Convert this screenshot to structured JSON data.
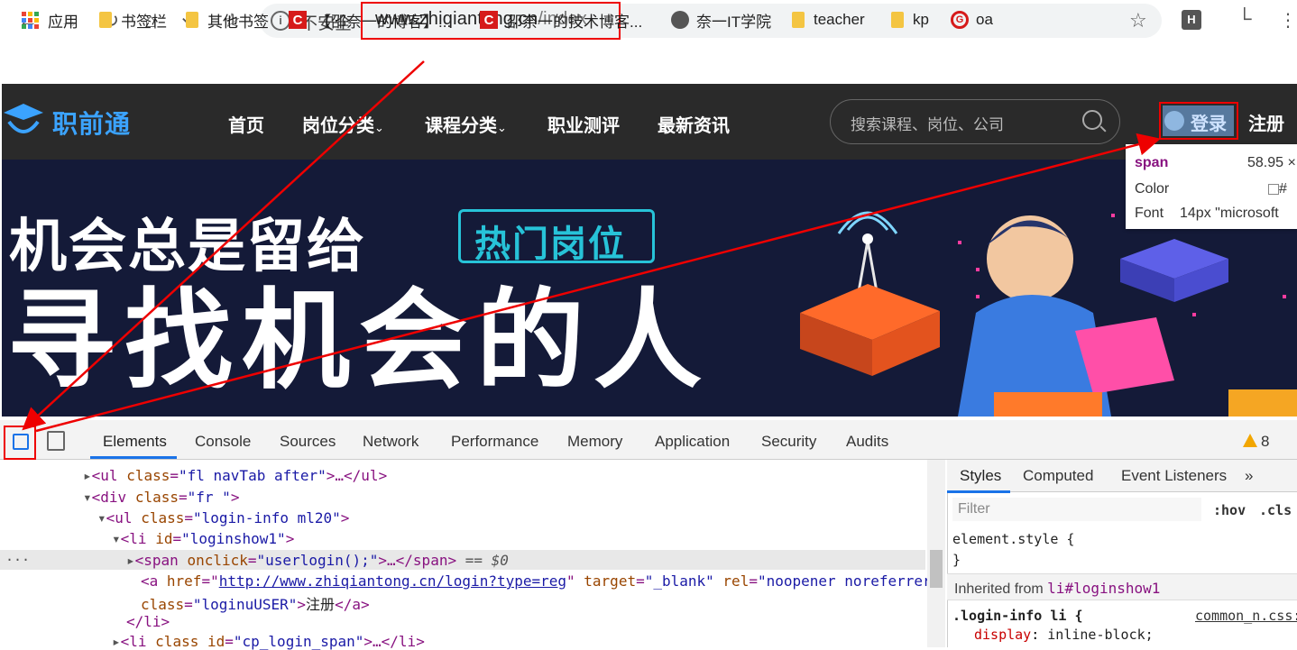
{
  "browser": {
    "insecure_label": "不安全",
    "url_host": "www.zhiqiantong.cn",
    "url_path": "/index",
    "ext_label": "H",
    "colors": {
      "annotation_red": "#ee0000"
    }
  },
  "bookmarks": [
    {
      "label": "应用",
      "icon": "apps-grid-icon"
    },
    {
      "label": "书签栏",
      "icon": "folder-icon"
    },
    {
      "label": "其他书签",
      "icon": "folder-icon"
    },
    {
      "label": "【邵奈一的博客】...",
      "icon": "csdn-icon"
    },
    {
      "label": "邵奈一的技术博客...",
      "icon": "csdn-icon"
    },
    {
      "label": "奈一IT学院",
      "icon": "globe-icon"
    },
    {
      "label": "teacher",
      "icon": "folder-icon"
    },
    {
      "label": "kp",
      "icon": "folder-icon"
    },
    {
      "label": "oa",
      "icon": "g-icon"
    }
  ],
  "site": {
    "logo_text": "职前通",
    "nav": [
      "首页",
      "岗位分类",
      "课程分类",
      "职业测评",
      "最新资讯"
    ],
    "search_placeholder": "搜索课程、岗位、公司",
    "login": "登录",
    "register": "注册",
    "banner_line1": "机会总是留给",
    "banner_tag": "热门岗位",
    "banner_line2": "寻找机会的人"
  },
  "tooltip": {
    "tag": "span",
    "size": "58.95 ×",
    "color_label": "Color",
    "color_value": "#",
    "font_label": "Font",
    "font_value": "14px \"microsoft"
  },
  "devtools": {
    "tabs": [
      "Elements",
      "Console",
      "Sources",
      "Network",
      "Performance",
      "Memory",
      "Application",
      "Security",
      "Audits"
    ],
    "warning_count": "8",
    "styles_tabs": [
      "Styles",
      "Computed",
      "Event Listeners"
    ],
    "styles_more": "»",
    "filter_placeholder": "Filter",
    "hov": ":hov",
    "cls": ".cls",
    "element_style": "element.style {",
    "close_brace": "}",
    "inherited_label": "Inherited from",
    "inherited_selector": "li#loginshow1",
    "rule_selector": ".login-info li {",
    "rule_source": "common_n.css:",
    "rule_prop": "display",
    "rule_value": "inline-block;",
    "dom": {
      "l1_tag": "ul",
      "l1_attr": "class",
      "l1_val": "\"fl navTab after\"",
      "l2_tag": "div",
      "l2_attr": "class",
      "l2_val": "\"fr \"",
      "l3_tag": "ul",
      "l3_attr": "class",
      "l3_val": "\"login-info ml20\"",
      "l4_tag": "li",
      "l4_attr": "id",
      "l4_val": "\"loginshow1\"",
      "l5_tag": "span",
      "l5_attr": "onclick",
      "l5_val": "\"userlogin();\"",
      "l5_suffix": "== $0",
      "l6_attr1": "href",
      "l6_val1": "http://www.zhiqiantong.cn/login?type=reg",
      "l6_attr2": "target",
      "l6_val2": "\"_blank\"",
      "l6_attr3": "rel",
      "l6_val3": "\"noopener noreferrer\"",
      "l7_attr": "class",
      "l7_val": "\"loginuUSER\"",
      "l7_text": "注册",
      "l8_close": "</li>",
      "l9_attr1": "class",
      "l9_attr2": "id",
      "l9_val2": "\"cp_login_span\""
    }
  }
}
